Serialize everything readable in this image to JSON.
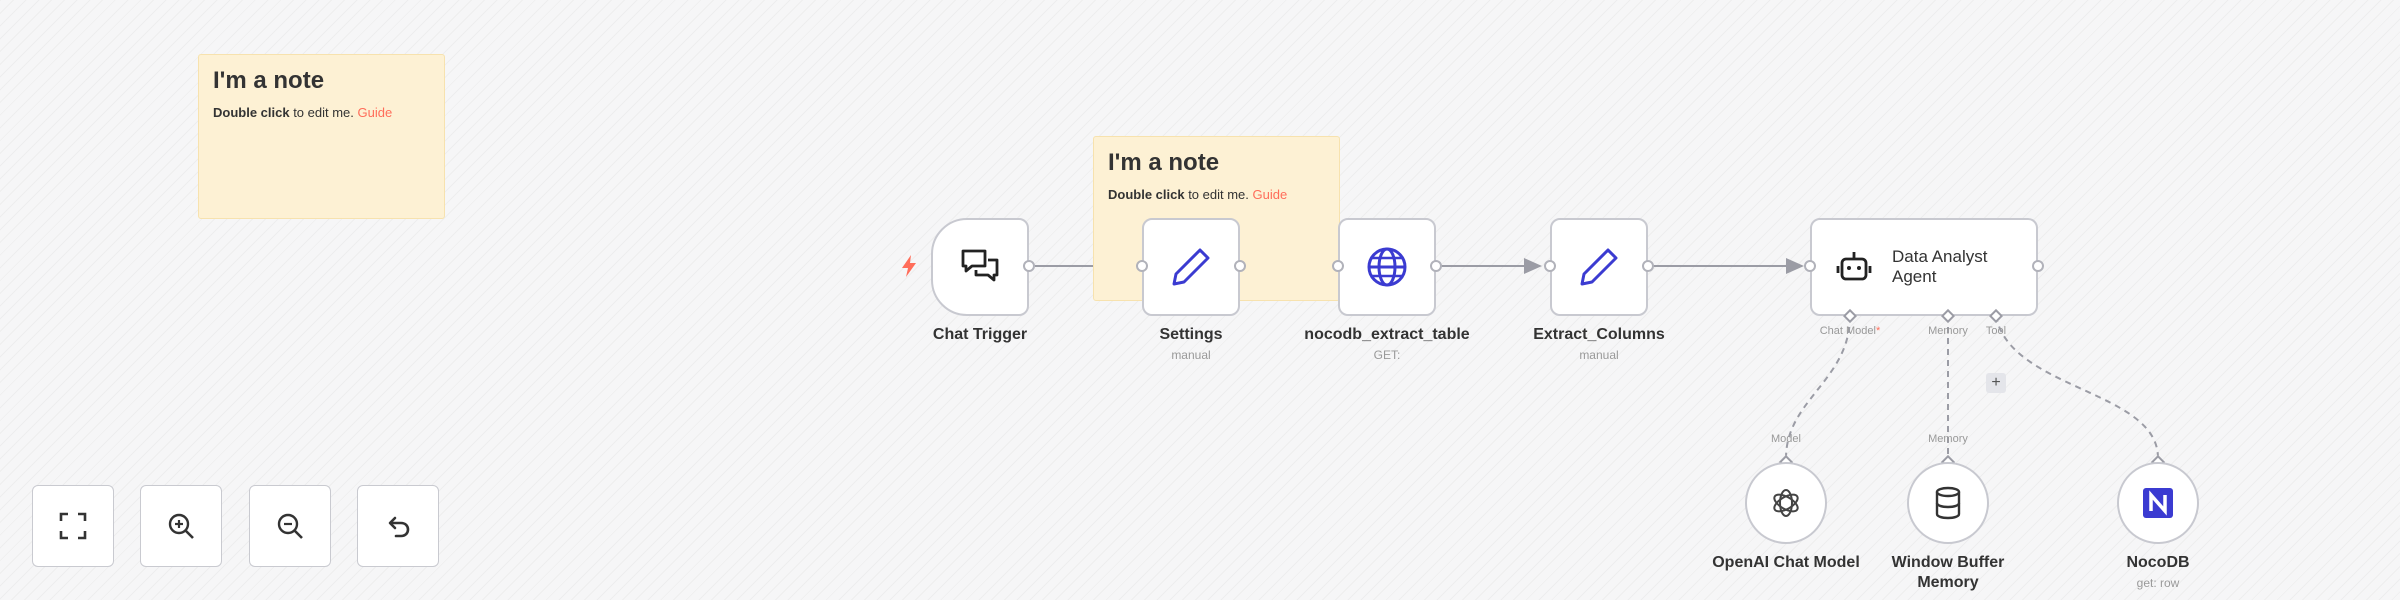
{
  "notes": [
    {
      "title": "I'm a note",
      "body_bold": "Double click",
      "body_text": " to edit me. ",
      "link": "Guide"
    },
    {
      "title": "I'm a note",
      "body_bold": "Double click",
      "body_text": " to edit me. ",
      "link": "Guide"
    }
  ],
  "nodes": {
    "chat_trigger": {
      "name": "Chat Trigger",
      "icon": "chat-bubbles-icon"
    },
    "settings": {
      "name": "Settings",
      "sub": "manual",
      "icon": "pencil-icon"
    },
    "nocodb_extract_table": {
      "name": "nocodb_extract_table",
      "sub": "GET:",
      "icon": "globe-icon"
    },
    "extract_columns": {
      "name": "Extract_Columns",
      "sub": "manual",
      "icon": "pencil-icon"
    },
    "agent": {
      "title_line1": "Data Analyst",
      "title_line2": "Agent",
      "icon": "robot-icon"
    },
    "openai": {
      "name": "OpenAI Chat Model",
      "icon": "openai-icon"
    },
    "memory": {
      "name_line1": "Window Buffer",
      "name_line2": "Memory",
      "icon": "database-icon"
    },
    "nocodb": {
      "name": "NocoDB",
      "sub": "get: row",
      "icon": "nocodb-icon"
    }
  },
  "ports": {
    "chat_model": "Chat Model",
    "chat_model_required": "*",
    "memory": "Memory",
    "tool": "Tool",
    "model_input": "Model",
    "memory_input": "Memory"
  },
  "plus_label": "+",
  "controls": {
    "fit": "fit-view-icon",
    "zoom_in": "zoom-in-icon",
    "zoom_out": "zoom-out-icon",
    "reset": "undo-icon"
  },
  "colors": {
    "accent": "#ff6d5a",
    "icon_blue": "#3b3bd1",
    "node_border": "#c8c9d0",
    "note_bg": "#fdf1d4"
  }
}
